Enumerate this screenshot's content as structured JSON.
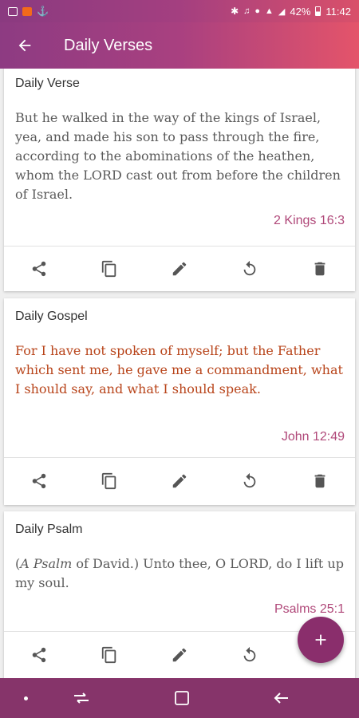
{
  "status_bar": {
    "battery": "42%",
    "time": "11:42"
  },
  "app_bar": {
    "title": "Daily Verses"
  },
  "cards": [
    {
      "title": "Daily Verse",
      "text": "But he walked in the way of the kings of Israel, yea, and made his son to pass through the fire, according to the abominations of the heathen, whom the LORD cast out from before the children of Israel.",
      "reference": "2 Kings 16:3"
    },
    {
      "title": "Daily Gospel",
      "text": "For I have not spoken of myself; but the Father which sent me, he gave me a commandment, what I should say, and what I should speak.",
      "reference": "John 12:49"
    },
    {
      "title": "Daily Psalm",
      "text_italic": "A Psalm",
      "text_rest": " of David.) Unto thee, O LORD, do I lift up my soul.",
      "text_open": "(",
      "reference": "Psalms 25:1"
    }
  ],
  "actions": [
    "share-icon",
    "copy-icon",
    "edit-icon",
    "refresh-icon",
    "delete-icon"
  ],
  "fab": {
    "icon": "add-icon"
  },
  "colors": {
    "accent": "#b04879",
    "gospel_text": "#b8441a",
    "fab": "#8a2e6c",
    "nav": "#86346a"
  }
}
